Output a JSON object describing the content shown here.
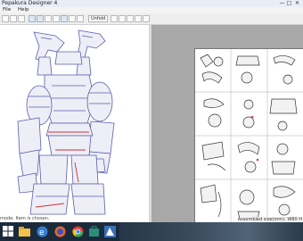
{
  "window": {
    "title": "Pepakura Designer 4",
    "controls": [
      "—",
      "□",
      "✕"
    ]
  },
  "menu": {
    "items": [
      "File",
      "Help"
    ]
  },
  "toolbar": {
    "unfold_label": "Unfold"
  },
  "view3d": {
    "status_text": "mode: Item is chosen."
  },
  "view2d": {
    "status_text": "Assembled size(mm): W80 H"
  },
  "taskbar": {
    "apps": [
      "start",
      "file-explorer",
      "edge",
      "firefox",
      "chrome",
      "store",
      "pepakura"
    ]
  }
}
